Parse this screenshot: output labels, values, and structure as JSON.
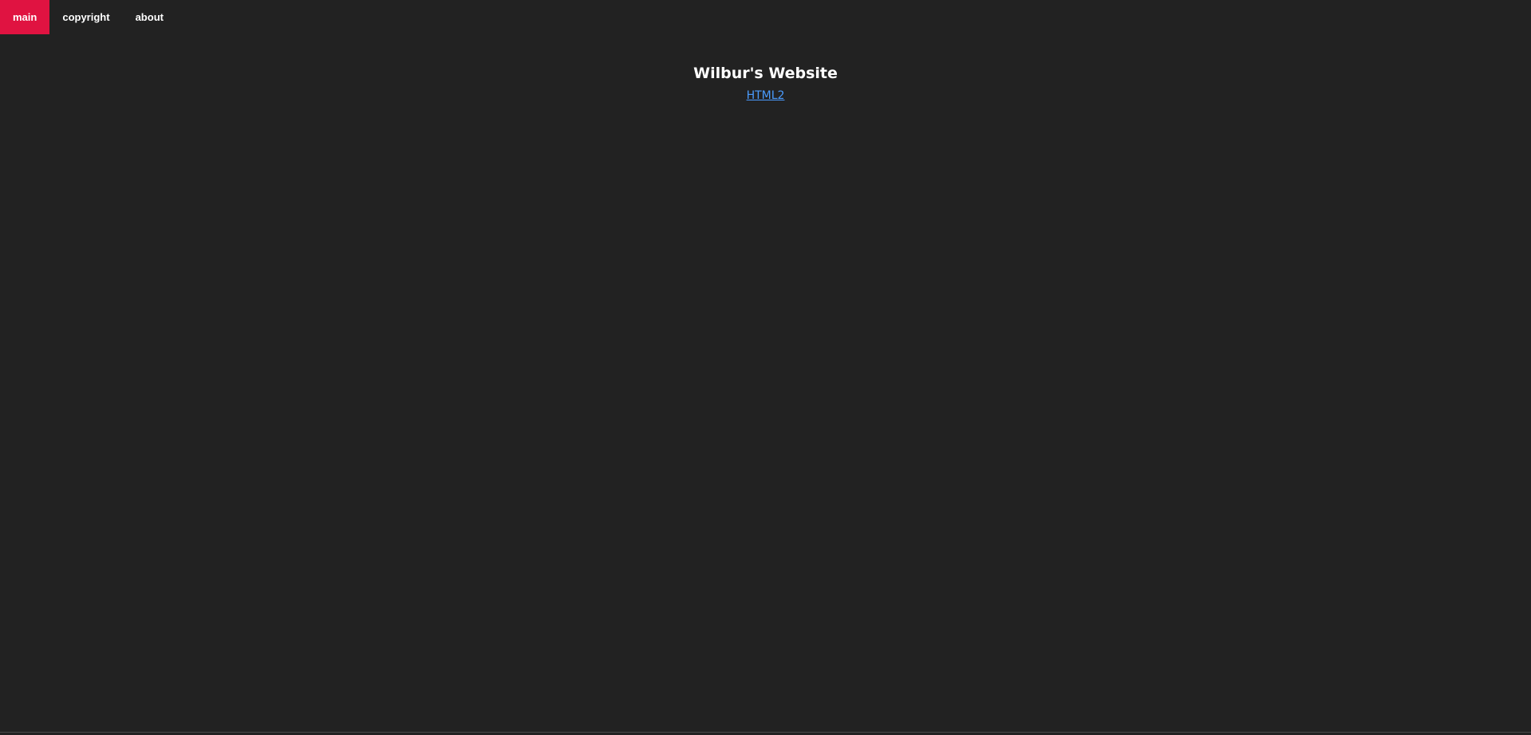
{
  "nav": {
    "items": [
      {
        "label": "main",
        "active": true
      },
      {
        "label": "copyright",
        "active": false
      },
      {
        "label": "about",
        "active": false
      }
    ]
  },
  "main": {
    "title": "Wilbur's Website",
    "link": "HTML2"
  },
  "colors": {
    "background": "#222222",
    "accent": "#e01341",
    "link": "#4a9cff"
  }
}
